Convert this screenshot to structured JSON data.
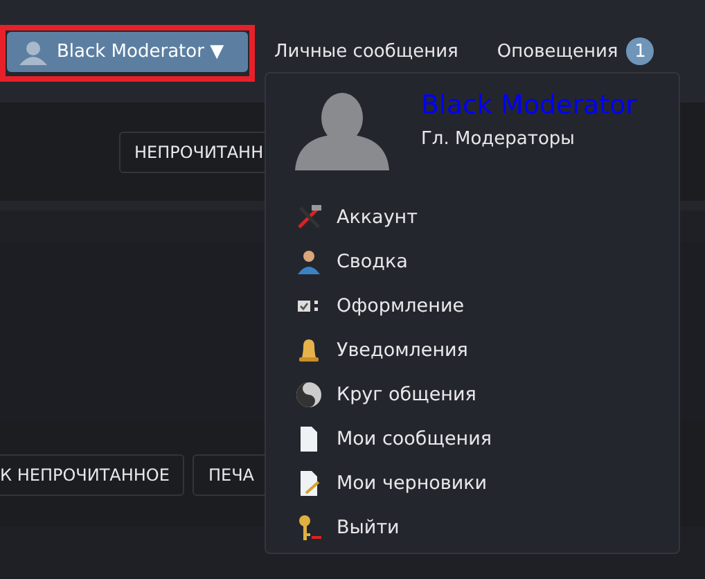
{
  "header": {
    "user_button": {
      "label": "Black Moderator",
      "caret": "▼"
    },
    "links": [
      {
        "label": "Личные сообщения"
      },
      {
        "label": "Оповещения",
        "badge": "1"
      }
    ]
  },
  "page": {
    "top_button": "НЕПРОЧИТАНН",
    "bottom_buttons": [
      "К НЕПРОЧИТАННОЕ",
      "ПЕЧА"
    ]
  },
  "user_menu": {
    "name": "Black Moderator",
    "group": "Гл. Модераторы",
    "items": [
      {
        "label": "Аккаунт",
        "kind": "tools"
      },
      {
        "label": "Сводка",
        "kind": "person"
      },
      {
        "label": "Оформление",
        "kind": "checklist"
      },
      {
        "label": "Уведомления",
        "kind": "bell"
      },
      {
        "label": "Круг общения",
        "kind": "yinyang"
      },
      {
        "label": "Мои сообщения",
        "kind": "page"
      },
      {
        "label": "Мои черновики",
        "kind": "draft"
      },
      {
        "label": "Выйти",
        "kind": "key"
      }
    ]
  }
}
